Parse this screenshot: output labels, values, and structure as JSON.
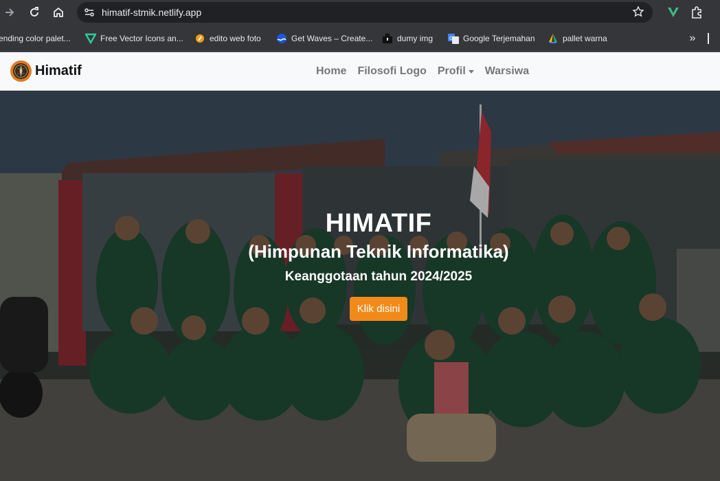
{
  "browser": {
    "url": "himatif-stmik.netlify.app",
    "bookmarks": [
      {
        "label": "ending color palet...",
        "icon": "none-icon"
      },
      {
        "label": "Free Vector Icons an...",
        "icon": "vector-icon"
      },
      {
        "label": "edito web foto",
        "icon": "pen-icon"
      },
      {
        "label": "Get Waves – Create...",
        "icon": "wave-icon"
      },
      {
        "label": "dumy img",
        "icon": "image-icon"
      },
      {
        "label": "Google Terjemahan",
        "icon": "translate-icon"
      },
      {
        "label": "pallet warna",
        "icon": "palette-icon"
      }
    ]
  },
  "navbar": {
    "brand": "Himatif",
    "links": [
      "Home",
      "Filosofi Logo",
      "Profil",
      "Warsiwa"
    ]
  },
  "hero": {
    "title": "HIMATIF",
    "subtitle": "(Himpunan Teknik Informatika)",
    "membership": "Keanggotaan tahun 2024/2025",
    "button": "Klik disini"
  },
  "colors": {
    "accent": "#f28a1a",
    "navbar_bg": "#f8f9fa",
    "nav_link": "#777777"
  }
}
